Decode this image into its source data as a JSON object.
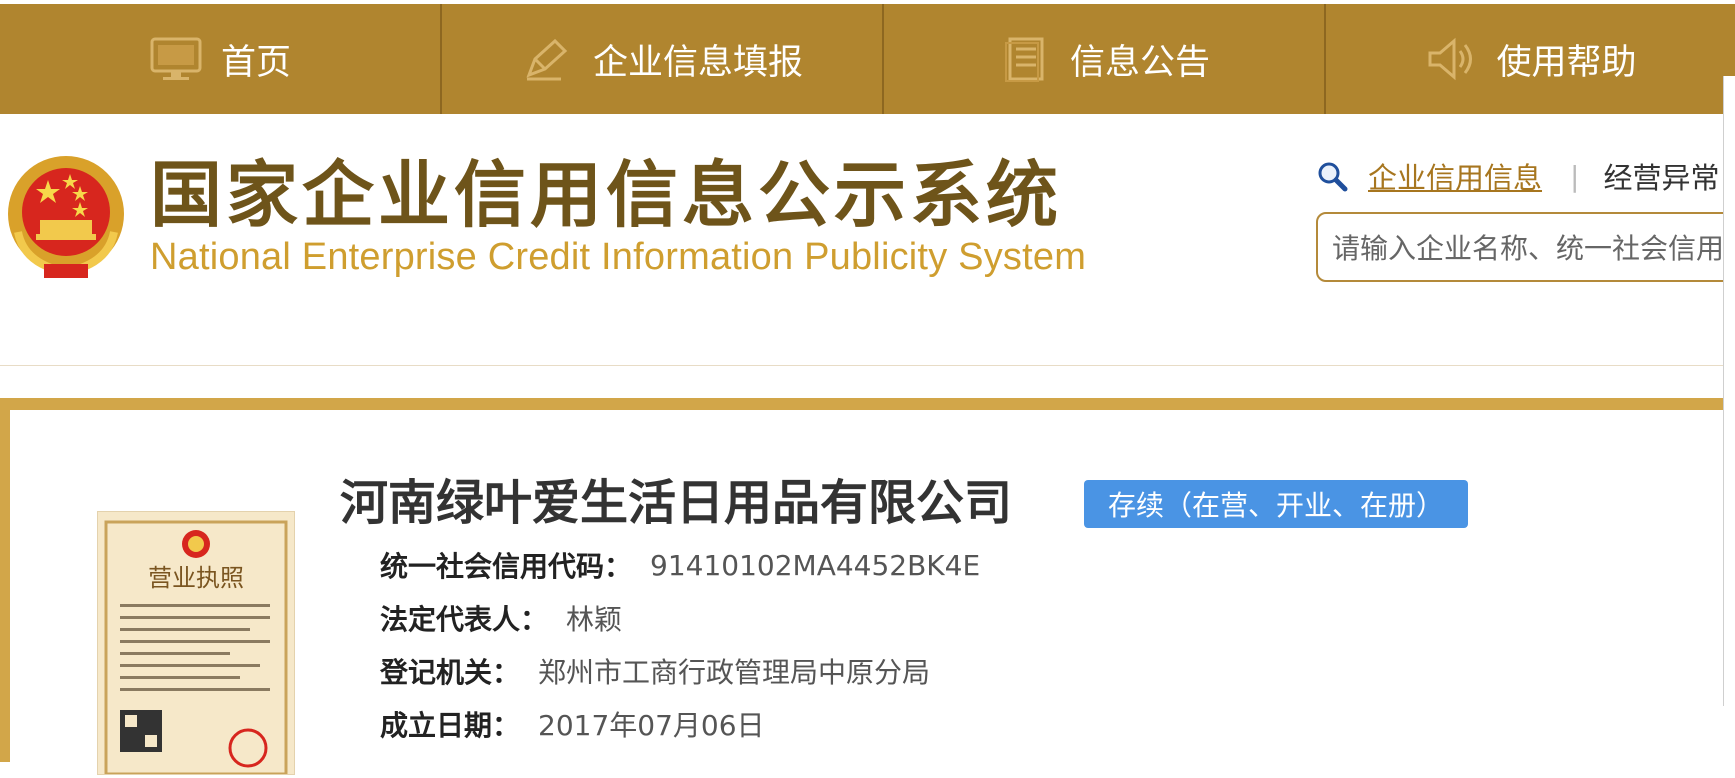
{
  "nav": {
    "items": [
      {
        "label": "首页",
        "icon": "monitor-icon"
      },
      {
        "label": "企业信息填报",
        "icon": "edit-icon"
      },
      {
        "label": "信息公告",
        "icon": "document-icon"
      },
      {
        "label": "使用帮助",
        "icon": "speaker-icon"
      }
    ]
  },
  "header": {
    "title_cn": "国家企业信用信息公示系统",
    "title_en": "National Enterprise Credit Information Publicity System",
    "search": {
      "link_credit": "企业信用信息",
      "separator": "|",
      "link_abnormal": "经营异常",
      "placeholder": "请输入企业名称、统一社会信用"
    }
  },
  "company": {
    "name": "河南绿叶爱生活日用品有限公司",
    "status": "存续（在营、开业、在册）",
    "fields": [
      {
        "label": "统一社会信用代码：",
        "value": "91410102MA4452BK4E"
      },
      {
        "label": "法定代表人：",
        "value": "林颖"
      },
      {
        "label": "登记机关：",
        "value": "郑州市工商行政管理局中原分局"
      },
      {
        "label": "成立日期：",
        "value": "2017年07月06日"
      }
    ],
    "license_title": "营业执照"
  },
  "colors": {
    "nav_bg": "#b0852f",
    "title": "#6e541a",
    "subtitle": "#cf9e2f",
    "status_badge": "#4a94e4"
  }
}
